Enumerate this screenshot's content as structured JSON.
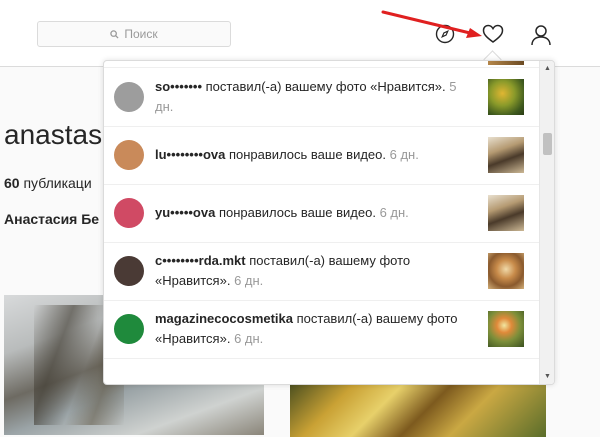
{
  "search": {
    "placeholder": "Поиск"
  },
  "profile": {
    "username": "anastas",
    "posts_count": "60",
    "posts_label": "публикаци",
    "full_name": "Анастасия Бе"
  },
  "notifications": [
    {
      "user": "so•••••••",
      "action": " поставил(-а) вашему фото «Нравится».",
      "time": "5 дн.",
      "avatar": "#9d9d9d",
      "thumb": "leaves"
    },
    {
      "user": "lu••••••••ova",
      "action": " понравилось ваше видео.",
      "time": "6 дн.",
      "avatar": "#c98a5a",
      "thumb": "room"
    },
    {
      "user": "yu•••••ova",
      "action": " понравилось ваше видео.",
      "time": "6 дн.",
      "avatar": "#d04a64",
      "thumb": "room"
    },
    {
      "user": "c••••••••rda.mkt",
      "action": " поставил(-а) вашему фото «Нравится».",
      "time": "6 дн.",
      "avatar": "#4a3a35",
      "thumb": "ornate"
    },
    {
      "user": "magazinecocosmetika",
      "action": " поставил(-а) вашему фото «Нравится».",
      "time": "6 дн.",
      "avatar": "#1f8a3c",
      "thumb": "flowers"
    }
  ],
  "colors": {
    "accent_arrow": "#e02020",
    "border": "#dbdbdb"
  },
  "icons": {
    "explore": "compass-icon",
    "activity": "heart-icon",
    "profile": "user-icon",
    "search": "search-icon"
  }
}
